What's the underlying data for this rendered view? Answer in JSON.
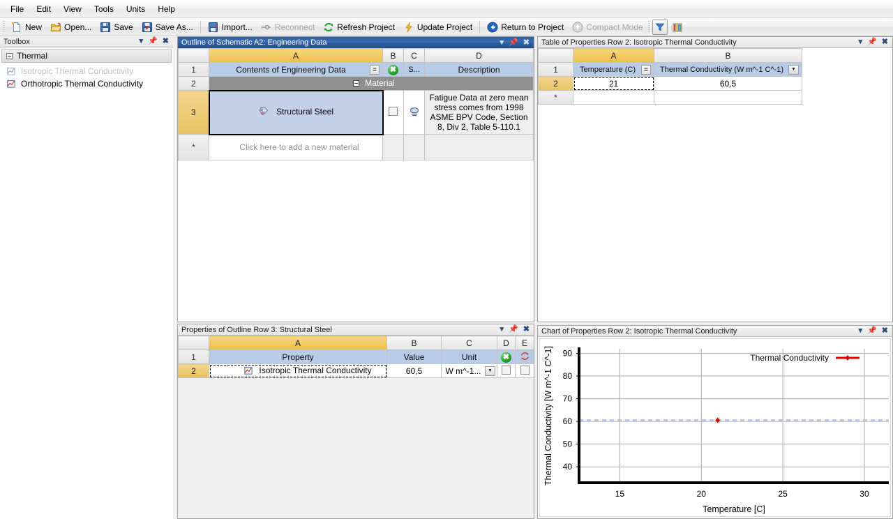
{
  "menu": {
    "items": [
      "File",
      "Edit",
      "View",
      "Tools",
      "Units",
      "Help"
    ]
  },
  "toolbar": {
    "new_label": "New",
    "open_label": "Open...",
    "save_label": "Save",
    "save_as_label": "Save As...",
    "import_label": "Import...",
    "reconnect_label": "Reconnect",
    "refresh_label": "Refresh Project",
    "update_label": "Update Project",
    "return_label": "Return to Project",
    "compact_label": "Compact Mode"
  },
  "toolbox": {
    "title": "Toolbox",
    "group_label": "Thermal",
    "items": [
      {
        "label": "Isotropic Thermal Conductivity",
        "enabled": false
      },
      {
        "label": "Orthotropic Thermal Conductivity",
        "enabled": true
      }
    ]
  },
  "outline": {
    "title": "Outline of Schematic A2: Engineering Data",
    "columns": [
      "",
      "A",
      "B",
      "C",
      "D"
    ],
    "header_row": {
      "index": "1",
      "a": "Contents of Engineering Data",
      "c": "S...",
      "d": "Description"
    },
    "group_row": {
      "index": "2",
      "label": "Material"
    },
    "material_row": {
      "index": "3",
      "name": "Structural Steel",
      "description": "Fatigue Data at zero mean stress comes from 1998 ASME BPV Code, Section 8, Div 2, Table 5-110.1"
    },
    "new_row": {
      "index": "*",
      "placeholder": "Click here to add a new material"
    }
  },
  "table_props": {
    "title": "Table of Properties Row 2: Isotropic Thermal Conductivity",
    "columns": [
      "",
      "A",
      "B"
    ],
    "header_row": {
      "index": "1",
      "a": "Temperature (C)",
      "b": "Thermal Conductivity (W m^-1 C^-1)"
    },
    "rows": [
      {
        "index": "2",
        "a": "21",
        "b": "60,5"
      },
      {
        "index": "*",
        "a": "",
        "b": ""
      }
    ]
  },
  "props": {
    "title": "Properties of Outline Row 3: Structural Steel",
    "columns": [
      "",
      "A",
      "B",
      "C",
      "D",
      "E"
    ],
    "header_row": {
      "index": "1",
      "property": "Property",
      "value": "Value",
      "unit": "Unit"
    },
    "rows": [
      {
        "index": "2",
        "property": "Isotropic Thermal Conductivity",
        "value": "60,5",
        "unit": "W m^-1..."
      }
    ]
  },
  "chart": {
    "title": "Chart of Properties Row 2: Isotropic Thermal Conductivity"
  },
  "chart_data": {
    "type": "scatter",
    "title": "",
    "xlabel": "Temperature [C]",
    "ylabel": "Thermal Conductivity [W m^-1 C^-1]",
    "xlim": [
      12.5,
      31.5
    ],
    "ylim": [
      33,
      92
    ],
    "xticks": [
      15,
      20,
      25,
      30
    ],
    "yticks": [
      40,
      50,
      60,
      70,
      80,
      90
    ],
    "grid": true,
    "legend_position": "top-right",
    "series": [
      {
        "name": "Thermal Conductivity",
        "color": "#e00000",
        "x": [
          21
        ],
        "y": [
          60.5
        ]
      }
    ],
    "reference_line": {
      "y": 60.5,
      "color": "#b5bfe8",
      "style": "dashed"
    }
  },
  "colors": {
    "accent_blue": "#2d5c9e",
    "field_header": "#b8cce8",
    "selected_header": "#e9bd4d",
    "series_red": "#e00000"
  }
}
